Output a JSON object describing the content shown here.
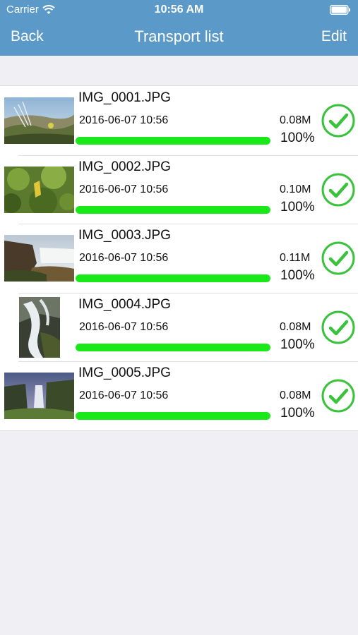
{
  "status_bar": {
    "carrier": "Carrier",
    "time": "10:56 AM"
  },
  "nav": {
    "back_label": "Back",
    "title": "Transport list",
    "edit_label": "Edit"
  },
  "colors": {
    "nav_background": "#5b9ac8",
    "progress_fill": "#19e819",
    "check_green": "#39c23b",
    "page_background": "#efeff4"
  },
  "transfers": [
    {
      "name": "IMG_0001.JPG",
      "date": "2016-06-07 10:56",
      "size": "0.08M",
      "progress_label": "100%",
      "progress": 1.0,
      "status_icon": "check-circle-icon"
    },
    {
      "name": "IMG_0002.JPG",
      "date": "2016-06-07 10:56",
      "size": "0.10M",
      "progress_label": "100%",
      "progress": 1.0,
      "status_icon": "check-circle-icon"
    },
    {
      "name": "IMG_0003.JPG",
      "date": "2016-06-07 10:56",
      "size": "0.11M",
      "progress_label": "100%",
      "progress": 1.0,
      "status_icon": "check-circle-icon"
    },
    {
      "name": "IMG_0004.JPG",
      "date": "2016-06-07 10:56",
      "size": "0.08M",
      "progress_label": "100%",
      "progress": 1.0,
      "status_icon": "check-circle-icon"
    },
    {
      "name": "IMG_0005.JPG",
      "date": "2016-06-07 10:56",
      "size": "0.08M",
      "progress_label": "100%",
      "progress": 1.0,
      "status_icon": "check-circle-icon"
    }
  ]
}
